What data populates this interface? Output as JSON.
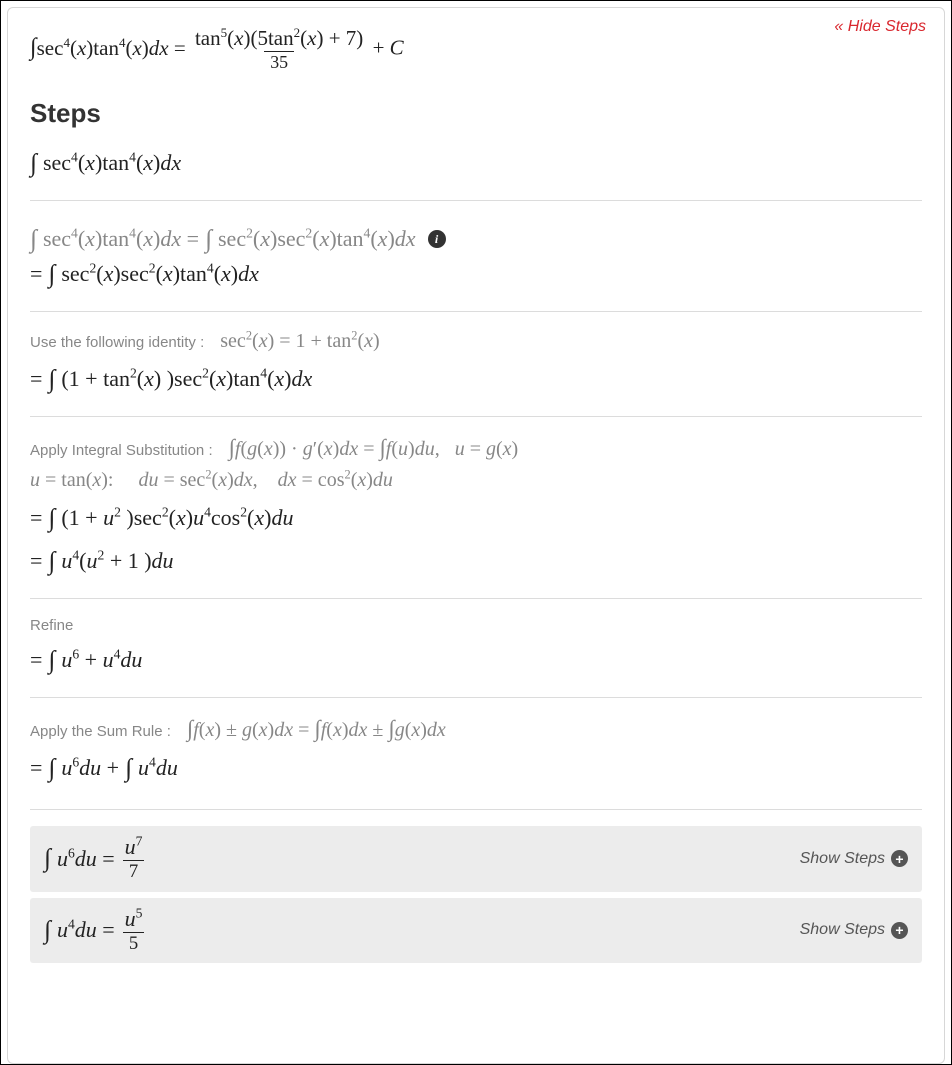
{
  "hide_steps_label": "« Hide Steps",
  "steps_heading": "Steps",
  "show_steps_label": "Show Steps",
  "result": {
    "lhs": "∫ sec⁴(x) tan⁴(x) dx",
    "rhs_num": "tan⁵(x)(5tan²(x) + 7)",
    "rhs_den": "35",
    "plus_c": "+ C"
  },
  "restate": "∫ sec⁴(x) tan⁴(x) dx",
  "step1": {
    "gray": "∫ sec⁴(x) tan⁴(x) dx = ∫ sec²(x) sec²(x) tan⁴(x) dx",
    "result": "= ∫ sec²(x) sec²(x) tan⁴(x) dx"
  },
  "step2": {
    "hint_label": "Use the following identity :",
    "hint_math": "sec²(x) = 1 + tan²(x)",
    "result": "= ∫ (1 + tan²(x)) sec²(x) tan⁴(x) dx"
  },
  "step3": {
    "hint_label": "Apply Integral Substitution :",
    "hint_math": "∫ f(g(x)) · g′(x) dx = ∫ f(u) du,   u = g(x)",
    "hint_line2": "u = tan(x):     du = sec²(x) dx,   dx = cos²(x) du",
    "result1": "= ∫ (1 + u²) sec²(x) u⁴ cos²(x) du",
    "result2": "= ∫ u⁴(u² + 1) du"
  },
  "step4": {
    "hint_label": "Refine",
    "result": "= ∫ u⁶ + u⁴ du"
  },
  "step5": {
    "hint_label": "Apply the Sum Rule :",
    "hint_math": "∫ f(x) ± g(x) dx = ∫ f(x) dx ± ∫ g(x) dx",
    "result": "= ∫ u⁶ du + ∫ u⁴ du"
  },
  "sub_results": [
    {
      "lhs": "∫ u⁶ du =",
      "num": "u⁷",
      "den": "7"
    },
    {
      "lhs": "∫ u⁴ du =",
      "num": "u⁵",
      "den": "5"
    }
  ]
}
